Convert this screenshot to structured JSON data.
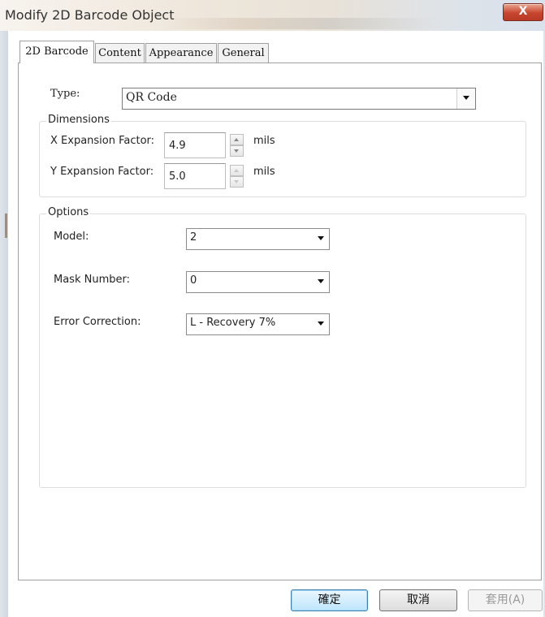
{
  "window": {
    "title": "Modify 2D Barcode Object",
    "close_label": "X"
  },
  "tabs": [
    {
      "label": "2D Barcode",
      "active": true
    },
    {
      "label": "Content",
      "active": false
    },
    {
      "label": "Appearance",
      "active": false
    },
    {
      "label": "General",
      "active": false
    }
  ],
  "type": {
    "label": "Type:",
    "value": "QR Code"
  },
  "dimensions": {
    "legend": "Dimensions",
    "x": {
      "label": "X Expansion Factor:",
      "value": "4.9",
      "unit": "mils"
    },
    "y": {
      "label": "Y Expansion Factor:",
      "value": "5.0",
      "unit": "mils"
    }
  },
  "options": {
    "legend": "Options",
    "model": {
      "label": "Model:",
      "value": "2"
    },
    "mask": {
      "label": "Mask Number:",
      "value": "0"
    },
    "error": {
      "label": "Error Correction:",
      "value": "L - Recovery 7%"
    }
  },
  "buttons": {
    "ok": "確定",
    "cancel": "取消",
    "apply": "套用(A)"
  },
  "colors": {
    "default_button": "#bee6fd",
    "close_button": "#c8452f"
  }
}
